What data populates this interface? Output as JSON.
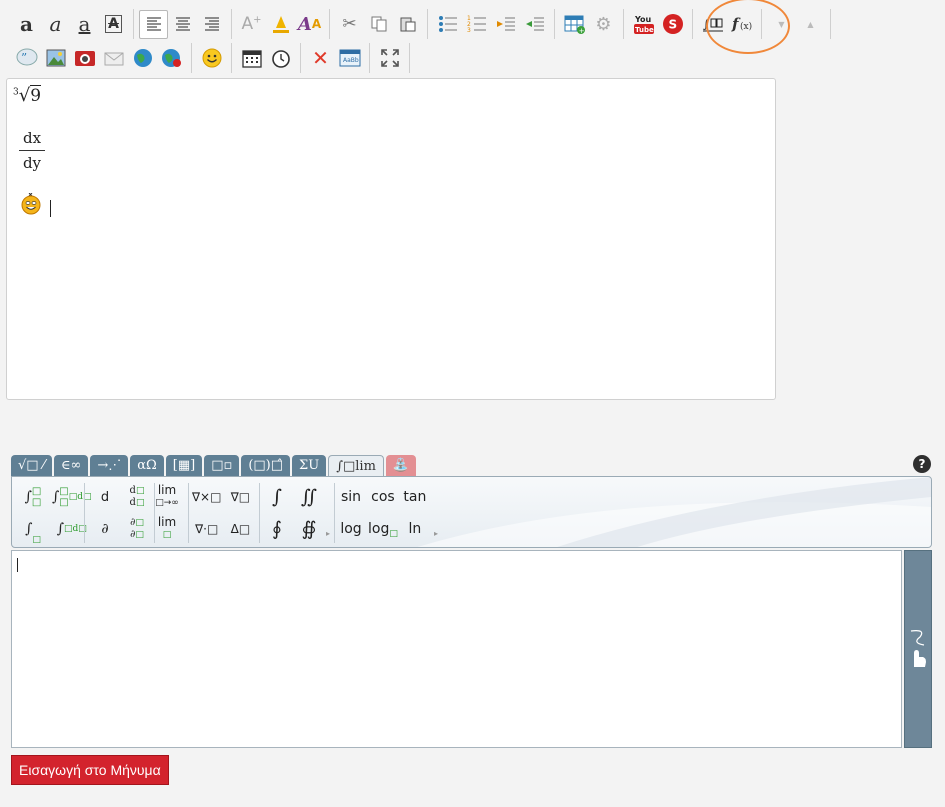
{
  "editor": {
    "content": {
      "root_index": "3",
      "root_radicand": "9",
      "fraction_numerator": "dx",
      "fraction_denominator": "dy"
    }
  },
  "math_tabs": [
    {
      "label": "√□ ⁄"
    },
    {
      "label": "∈∞"
    },
    {
      "label": "→⋰"
    },
    {
      "label": "αΩ"
    },
    {
      "label": "[▦]"
    },
    {
      "label": "□▫"
    },
    {
      "label": "(□)□̂"
    },
    {
      "label": "ΣU"
    },
    {
      "label": "∫□lim"
    },
    {
      "label": "⛲"
    }
  ],
  "palette": {
    "derivative_d": "d",
    "partial": "∂",
    "lim_top": "lim",
    "lim_top_sub": "□→∞",
    "lim_bottom": "lim",
    "curl": "∇×□",
    "grad": "∇□",
    "div": "∇·□",
    "laplace": "Δ□",
    "integral": "∫",
    "double_integral": "∬",
    "contour_integral": "∮",
    "surface_integral": "∯",
    "sin": "sin",
    "cos": "cos",
    "tan": "tan",
    "log": "log",
    "log_base": "log",
    "ln": "ln"
  },
  "help_label": "?",
  "insert_button_label": "Εισαγωγή στο Μήνυμα",
  "colors": {
    "tab_bg": "#5f7f94",
    "insert_button": "#d3232d",
    "highlight_ring": "#f0883a"
  }
}
